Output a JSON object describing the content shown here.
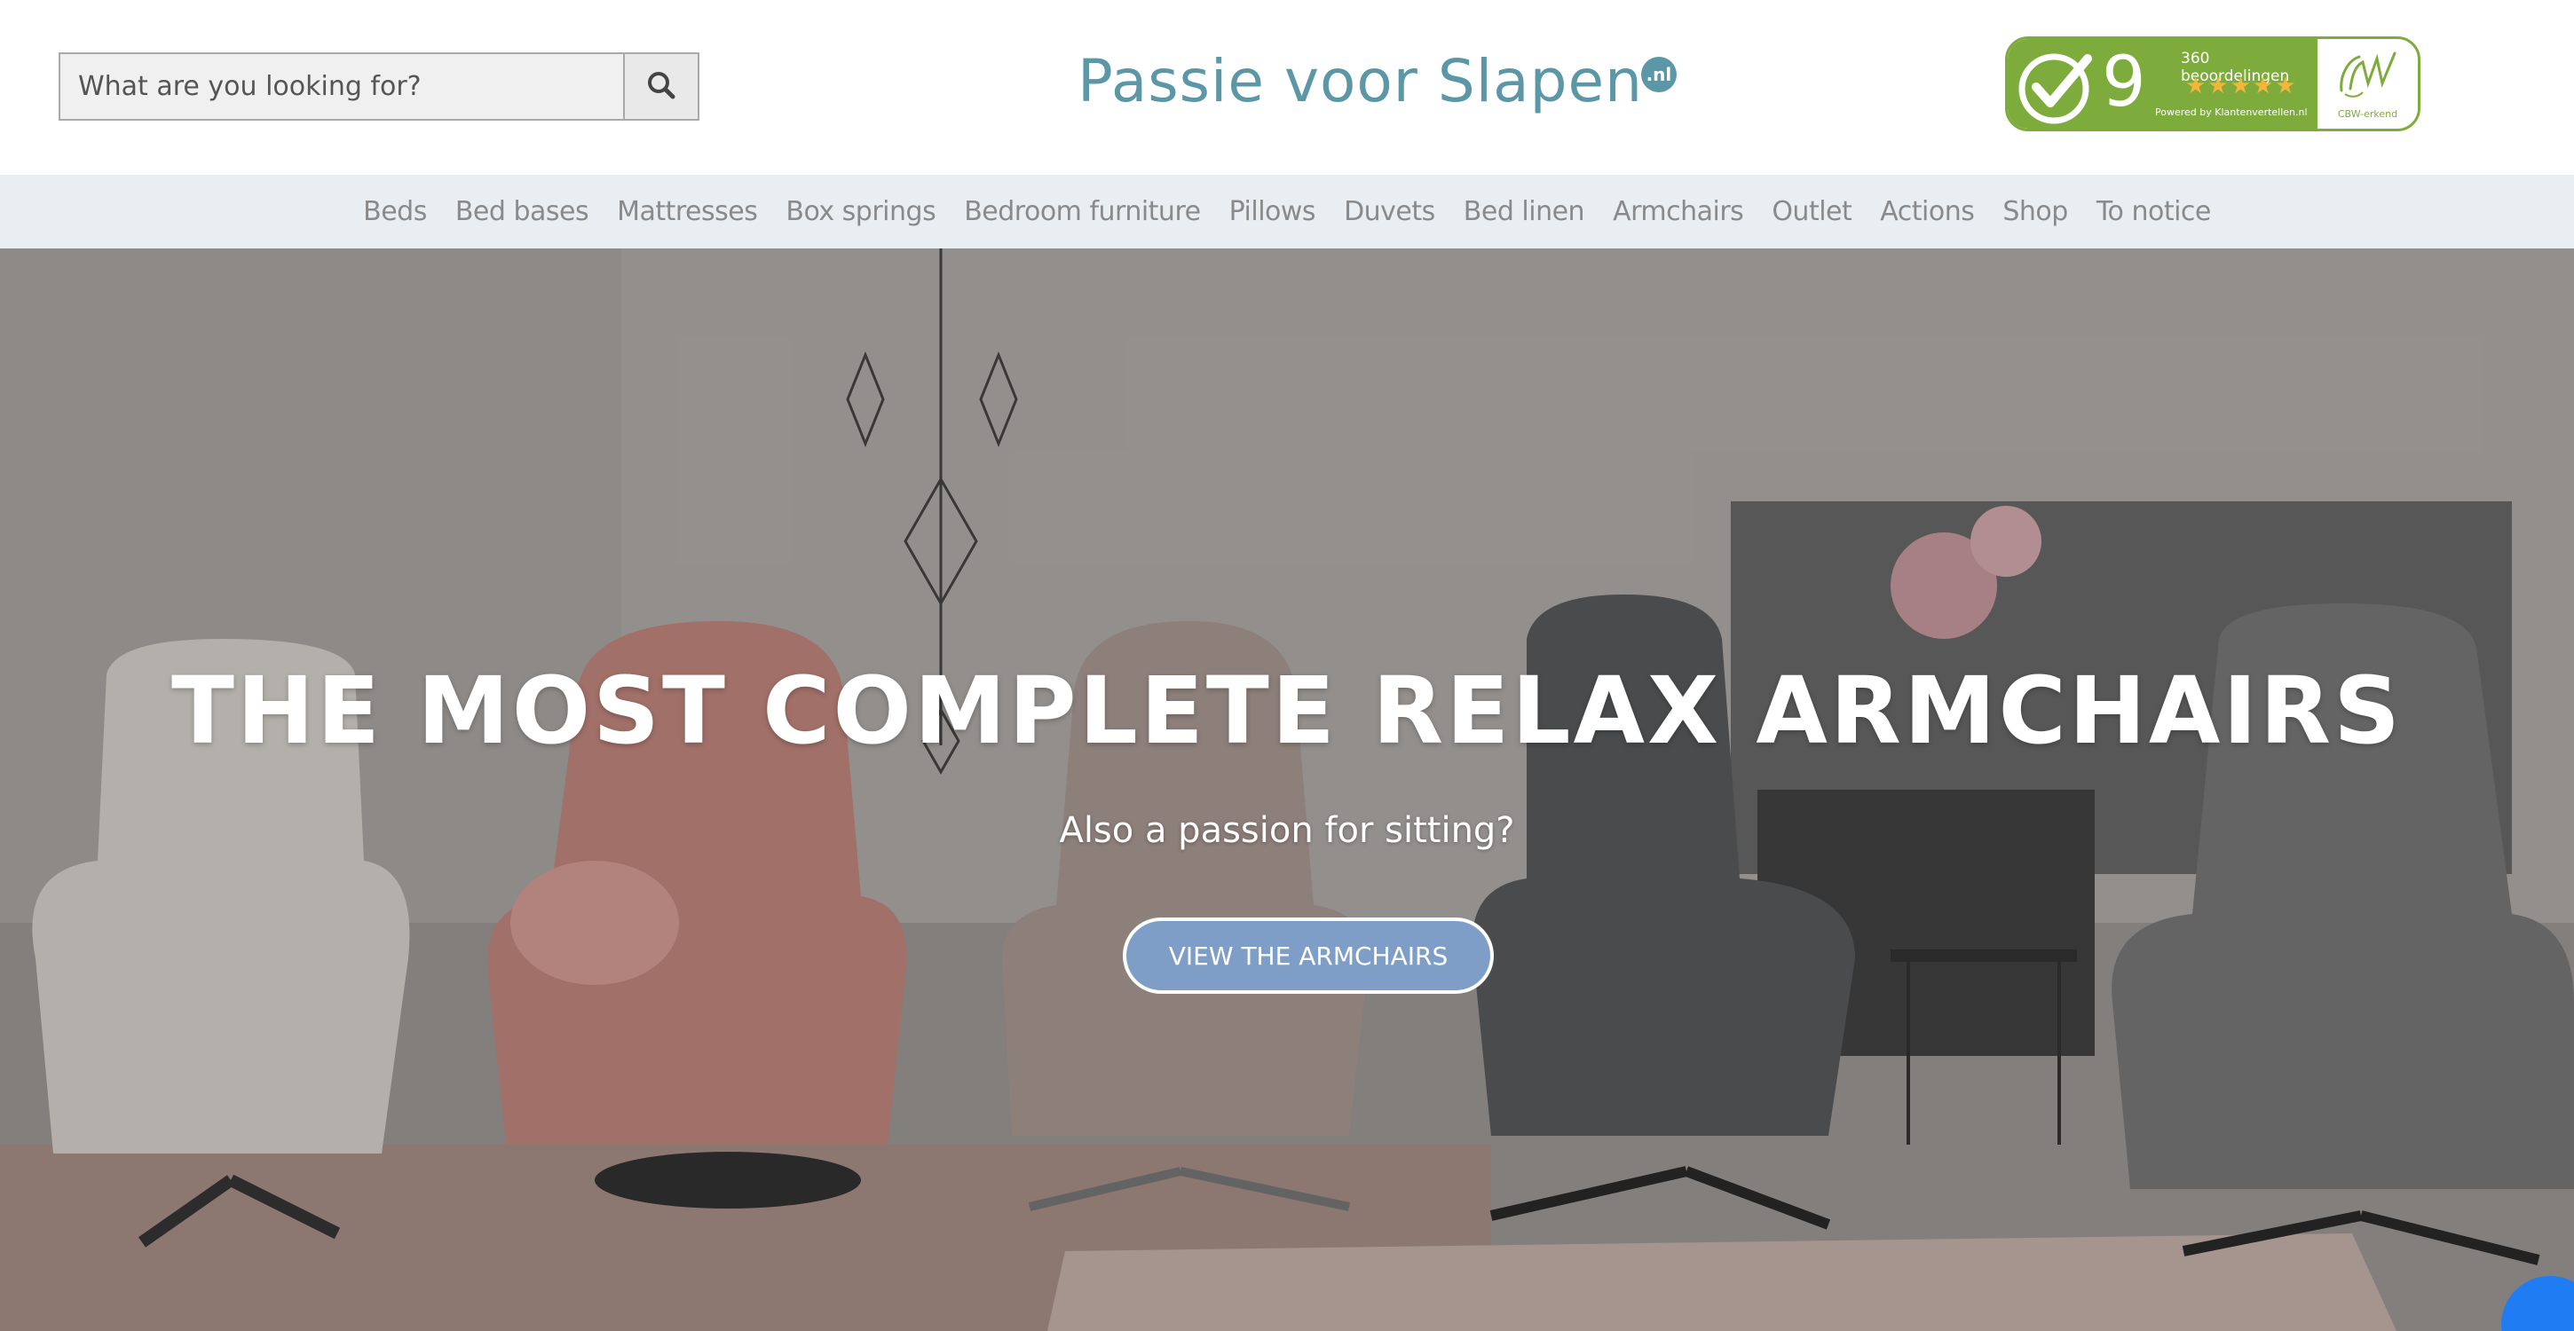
{
  "search": {
    "placeholder": "What are you looking for?",
    "button_icon": "search-icon"
  },
  "logo": {
    "text": "Passie voor Slapen",
    "badge": ".nl"
  },
  "review_widget": {
    "score": "9",
    "count_label": "360 beoordelingen",
    "stars": "★★★★★",
    "rating_fraction": 0.9,
    "powered_by": "Powered by Klantenvertellen.nl",
    "cbw_label": "CBW-erkend",
    "accent_color": "#7dab3c"
  },
  "nav": {
    "items": [
      {
        "label": "Beds"
      },
      {
        "label": "Bed bases"
      },
      {
        "label": "Mattresses"
      },
      {
        "label": "Box springs"
      },
      {
        "label": "Bedroom furniture"
      },
      {
        "label": "Pillows"
      },
      {
        "label": "Duvets"
      },
      {
        "label": "Bed linen"
      },
      {
        "label": "Armchairs"
      },
      {
        "label": "Outlet"
      },
      {
        "label": "Actions"
      },
      {
        "label": "Shop"
      },
      {
        "label": "To notice"
      }
    ]
  },
  "hero": {
    "title": "THE MOST COMPLETE RELAX ARMCHAIRS",
    "subtitle": "Also a passion for sitting?",
    "cta_label": "VIEW THE ARMCHAIRS",
    "cta_color": "#7f9ec7"
  },
  "chat": {
    "icon": "messenger-icon"
  }
}
